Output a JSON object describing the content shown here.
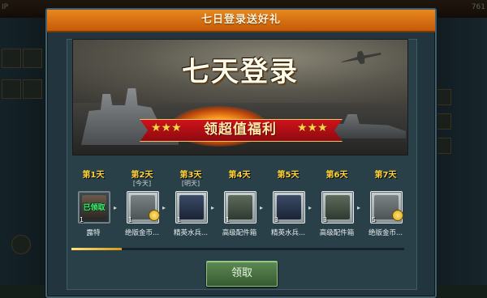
{
  "dialog": {
    "title": "七日登录送好礼",
    "claim_label": "领取"
  },
  "banner": {
    "headline": "七天登录",
    "ribbon_text": "领超值福利",
    "stars_left": "★★★",
    "stars_right": "★★★"
  },
  "background": {
    "top_right_value": "761",
    "top_left_text": "IP"
  },
  "days": [
    {
      "label": "第1天",
      "sub": "",
      "reward_name": "露特",
      "qty": "1",
      "status": "已领取",
      "icon": "captain-portrait-icon"
    },
    {
      "label": "第2天",
      "sub": "[今天]",
      "reward_name": "绝版金币...",
      "qty": "1",
      "status": "",
      "icon": "gold-coin-crate-icon"
    },
    {
      "label": "第3天",
      "sub": "[明天]",
      "reward_name": "精英水兵...",
      "qty": "1",
      "status": "",
      "icon": "elite-sailor-icon"
    },
    {
      "label": "第4天",
      "sub": "",
      "reward_name": "高级配件箱",
      "qty": "1",
      "status": "",
      "icon": "parts-box-icon"
    },
    {
      "label": "第5天",
      "sub": "",
      "reward_name": "精英水兵...",
      "qty": "3",
      "status": "",
      "icon": "elite-sailor-icon"
    },
    {
      "label": "第6天",
      "sub": "",
      "reward_name": "高级配件箱",
      "qty": "3",
      "status": "",
      "icon": "parts-box-icon"
    },
    {
      "label": "第7天",
      "sub": "",
      "reward_name": "绝版金币...",
      "qty": "5",
      "status": "",
      "icon": "gold-coin-crate-icon"
    }
  ],
  "progress": 0.15,
  "colors": {
    "title_bar": "#d96e12",
    "day_label": "#ffd23a",
    "claimed": "#45f07a",
    "claim_button": "#4a7542"
  }
}
